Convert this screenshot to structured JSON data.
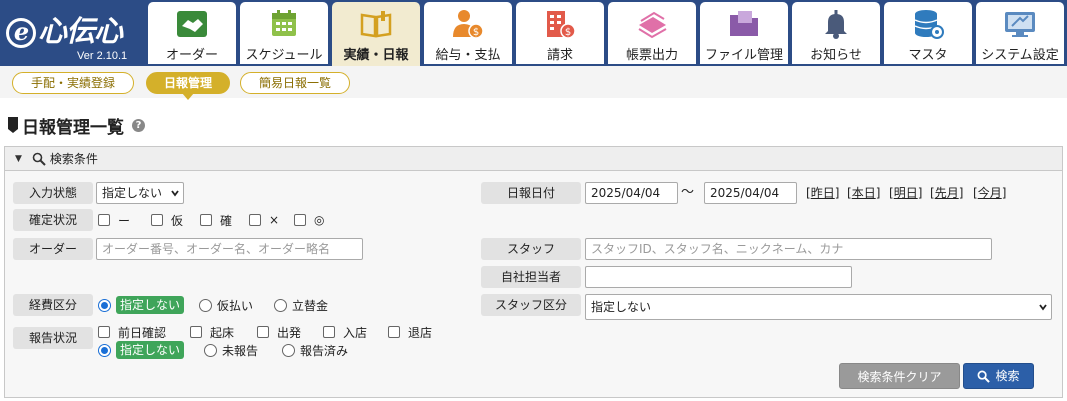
{
  "app": {
    "logo_text": "心伝心",
    "logo_e": "e",
    "version": "Ver 2.10.1"
  },
  "nav_tabs": [
    {
      "label": "オーダー",
      "icon": "handshake-icon",
      "active": false
    },
    {
      "label": "スケジュール",
      "icon": "calendar-icon",
      "active": false
    },
    {
      "label": "実績・日報",
      "icon": "book-icon",
      "active": true
    },
    {
      "label": "給与・支払",
      "icon": "person-money-icon",
      "active": false
    },
    {
      "label": "請求",
      "icon": "building-money-icon",
      "active": false
    },
    {
      "label": "帳票出力",
      "icon": "documents-icon",
      "active": false
    },
    {
      "label": "ファイル管理",
      "icon": "folder-icon",
      "active": false
    },
    {
      "label": "お知らせ",
      "icon": "bell-icon",
      "active": false
    },
    {
      "label": "マスタ",
      "icon": "database-icon",
      "active": false
    },
    {
      "label": "システム設定",
      "icon": "monitor-settings-icon",
      "active": false
    }
  ],
  "sub_nav": [
    {
      "label": "手配・実績登録",
      "active": false
    },
    {
      "label": "日報管理",
      "active": true
    },
    {
      "label": "簡易日報一覧",
      "active": false
    }
  ],
  "page": {
    "title": "日報管理一覧",
    "help": "?"
  },
  "search": {
    "header": "検索条件",
    "input_status": {
      "label": "入力状態",
      "value": "指定しない"
    },
    "confirm_status": {
      "label": "確定状況",
      "options": [
        "ー",
        "仮",
        "確",
        "×",
        "◎"
      ]
    },
    "order": {
      "label": "オーダー",
      "placeholder": "オーダー番号、オーダー名、オーダー略名"
    },
    "expense": {
      "label": "経費区分",
      "options": [
        "指定しない",
        "仮払い",
        "立替金"
      ],
      "selected": "指定しない"
    },
    "report": {
      "label": "報告状況",
      "checks": [
        "前日確認",
        "起床",
        "出発",
        "入店",
        "退店"
      ],
      "radios": [
        "指定しない",
        "未報告",
        "報告済み"
      ],
      "selected": "指定しない"
    },
    "date": {
      "label": "日報日付",
      "from": "2025/04/04",
      "sep": "～",
      "to": "2025/04/04",
      "quick_links": [
        "昨日",
        "本日",
        "明日",
        "先月",
        "今月"
      ]
    },
    "staff": {
      "label": "スタッフ",
      "placeholder": "スタッフID、スタッフ名、ニックネーム、カナ"
    },
    "company_rep": {
      "label": "自社担当者",
      "value": ""
    },
    "staff_type": {
      "label": "スタッフ区分",
      "value": "指定しない"
    },
    "clear_button": "検索条件クリア",
    "search_button": "検索"
  },
  "colors": {
    "header_bg": "#2c4c86",
    "active_tab_bg": "#f2ebd0",
    "pill_gold": "#d4b02a",
    "selected_green": "#3fa55a",
    "search_blue": "#2c5fa8"
  }
}
